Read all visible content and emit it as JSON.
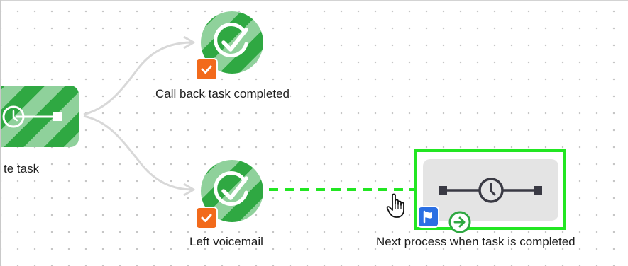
{
  "canvas": {
    "background": "#ffffff",
    "grid_dot_color": "#c4c4c4"
  },
  "nodes": {
    "left_task": {
      "label": "te task",
      "icon": "timer-line-icon",
      "color": "#2fa842"
    },
    "call_back": {
      "label": "Call back task completed",
      "icon": "check-circle-icon",
      "badge_icon": "checkbox-icon",
      "badge_color": "#f26a1b"
    },
    "left_voicemail": {
      "label": "Left voicemail",
      "icon": "check-circle-icon",
      "badge_icon": "checkbox-icon",
      "badge_color": "#f26a1b"
    },
    "next_process": {
      "label": "Next process when task is completed",
      "icon": "timer-line-icon",
      "selected": true,
      "selection_color": "#22e622",
      "flag_icon": "flag-icon",
      "flag_color": "#2b6fe3",
      "start_icon": "play-circle-icon"
    }
  },
  "edges": [
    {
      "from": "left_task",
      "to": "call_back",
      "style": "solid",
      "color": "#d6d6d6"
    },
    {
      "from": "left_task",
      "to": "left_voicemail",
      "style": "solid",
      "color": "#d6d6d6"
    },
    {
      "from": "left_voicemail",
      "to": "next_process",
      "style": "dashed",
      "color": "#22e622",
      "state": "connecting"
    }
  ],
  "cursor": {
    "icon": "hand-pointer-icon"
  }
}
